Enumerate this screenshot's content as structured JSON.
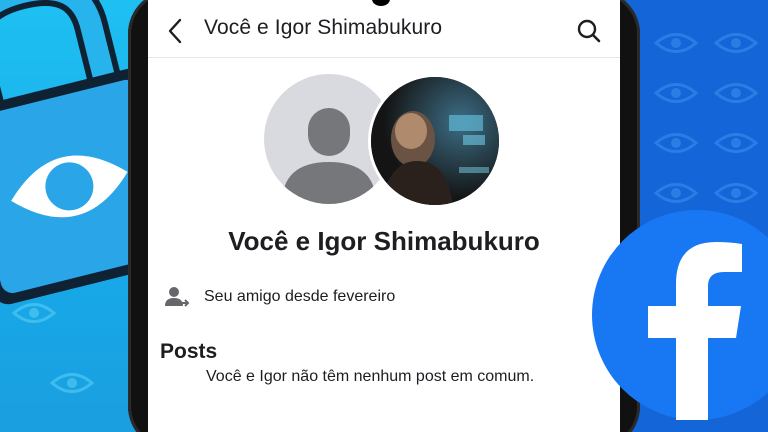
{
  "header": {
    "title": "Você e Igor Shimabukuro",
    "back_icon": "chevron-left-icon",
    "search_icon": "search-icon"
  },
  "profile": {
    "heading": "Você e Igor Shimabukuro",
    "friendship_text": "Seu amigo desde fevereiro",
    "friendship_icon": "friends-icon"
  },
  "posts": {
    "title": "Posts",
    "empty_message": "Você e Igor não têm nenhum post em comum."
  },
  "colors": {
    "left_background": "#1ec0f2",
    "right_background": "#1466d8",
    "facebook_blue": "#1877f2",
    "lock_blue": "#2aa6e8",
    "text_primary": "#1c1e21"
  }
}
